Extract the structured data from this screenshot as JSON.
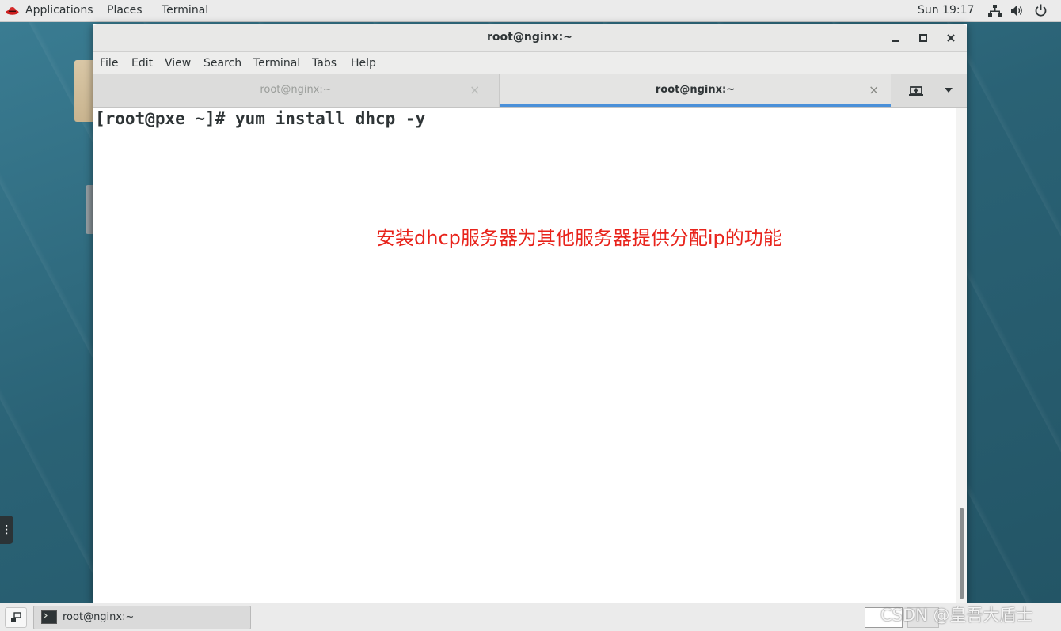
{
  "top_panel": {
    "applications": "Applications",
    "places": "Places",
    "terminal": "Terminal",
    "clock": "Sun 19:17",
    "icons": [
      "redhat-hat-icon",
      "network-icon",
      "volume-icon",
      "power-icon"
    ]
  },
  "window": {
    "title": "root@nginx:~",
    "controls": {
      "minimize": "_",
      "maximize": "□",
      "close": "×"
    },
    "menu": [
      "File",
      "Edit",
      "View",
      "Search",
      "Terminal",
      "Tabs",
      "Help"
    ],
    "tabs": [
      {
        "label": "root@nginx:~",
        "close": "×",
        "active": false
      },
      {
        "label": "root@nginx:~",
        "close": "×",
        "active": true
      }
    ],
    "terminal": {
      "command_line": "[root@pxe ~]# yum install dhcp -y",
      "annotation": "安装dhcp服务器为其他服务器提供分配ip的功能",
      "annotation_color": "#e8231b"
    }
  },
  "taskbar": {
    "task_label": "root@nginx:~",
    "watermark": "CSDN @皇吾大盾士"
  },
  "colors": {
    "desktop": "#2e6c80",
    "panel": "#ebebeb",
    "tab_accent": "#4a90d9"
  }
}
